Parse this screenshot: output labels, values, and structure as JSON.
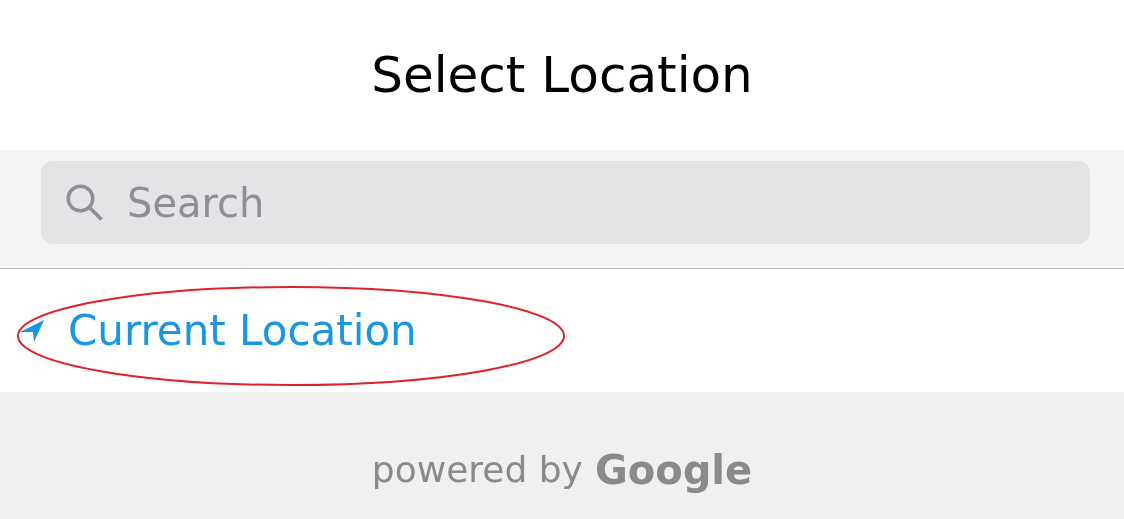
{
  "title": "Select Location",
  "search": {
    "placeholder": "Search"
  },
  "results": [
    {
      "label": "Current Location",
      "kind": "current",
      "highlighted": true
    }
  ],
  "footer": {
    "prefix": "powered by",
    "brand": "Google"
  }
}
